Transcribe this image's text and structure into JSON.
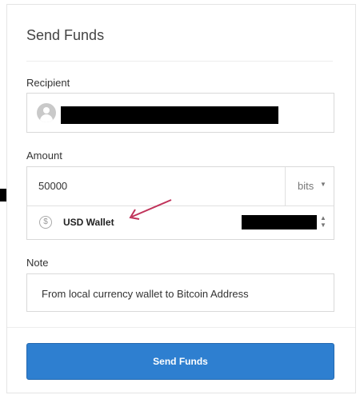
{
  "dialog": {
    "title": "Send Funds"
  },
  "recipient": {
    "label": "Recipient"
  },
  "amount": {
    "label": "Amount",
    "value": "50000",
    "unit": "bits",
    "wallet": "USD Wallet"
  },
  "note": {
    "label": "Note",
    "value": "From local currency wallet to Bitcoin Address"
  },
  "actions": {
    "send_label": "Send Funds"
  },
  "colors": {
    "primary": "#2e7fd0",
    "annotation_arrow": "#c0335a"
  },
  "icons": {
    "avatar": "user-avatar-icon",
    "currency": "dollar-circle-icon",
    "unit_dropdown": "caret-down-icon",
    "wallet_selector": "caret-updown-icon"
  }
}
